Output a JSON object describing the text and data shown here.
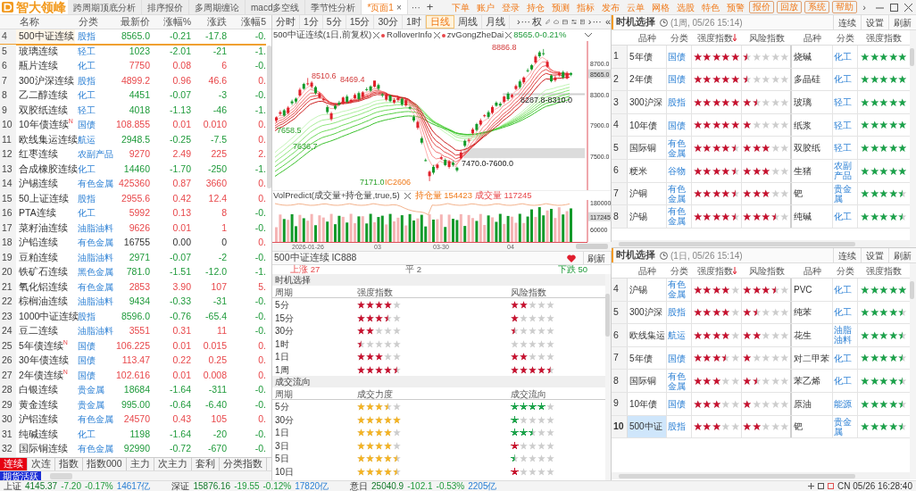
{
  "app": {
    "logo": "智大领峰",
    "tabs": [
      {
        "label": "跨周期顶底分析",
        "selected": false
      },
      {
        "label": "排序报价",
        "selected": false
      },
      {
        "label": "多周期缠论",
        "selected": false
      },
      {
        "label": "macd多空线",
        "selected": false
      },
      {
        "label": "季节性分析",
        "selected": false
      },
      {
        "label": "*页面1",
        "selected": true,
        "close": "×"
      }
    ],
    "tab_more": "···",
    "tab_add": "+",
    "menu": [
      {
        "label": "下单",
        "kind": "link"
      },
      {
        "label": "账户",
        "kind": "link"
      },
      {
        "label": "登录",
        "kind": "link"
      },
      {
        "label": "持仓",
        "kind": "link"
      },
      {
        "label": "预测",
        "kind": "link"
      },
      {
        "label": "指标",
        "kind": "link"
      },
      {
        "label": "发布",
        "kind": "link"
      },
      {
        "label": "云单",
        "kind": "link"
      },
      {
        "label": "网格",
        "kind": "link"
      },
      {
        "label": "选股",
        "kind": "link"
      },
      {
        "label": "特色",
        "kind": "link"
      },
      {
        "label": "预警",
        "kind": "link"
      },
      {
        "label": "报价",
        "kind": "button"
      },
      {
        "label": "回放",
        "kind": "button"
      },
      {
        "label": "系统",
        "kind": "button"
      },
      {
        "label": "帮助",
        "kind": "button"
      }
    ],
    "menu_more": "›"
  },
  "quote_list": {
    "columns": [
      "名称",
      "分类",
      "最新价",
      "涨幅%",
      "涨跌",
      "涨幅5"
    ],
    "rows": [
      {
        "index": "4",
        "name": "500中证连续",
        "category": "股指",
        "price": "8565.0",
        "percent": "-0.21",
        "change": "-17.8",
        "percent5": "-0.",
        "rising": false,
        "rising5": false,
        "selected": true
      },
      {
        "index": "5",
        "name": "玻璃连续",
        "category": "轻工",
        "price": "1023",
        "percent": "-2.01",
        "change": "-21",
        "percent5": "-1.",
        "rising": false,
        "rising5": false,
        "selected": false
      },
      {
        "index": "6",
        "name": "瓶片连续",
        "category": "化工",
        "price": "7750",
        "percent": "0.08",
        "change": "6",
        "percent5": "-0.",
        "rising": true,
        "rising5": false,
        "selected": false
      },
      {
        "index": "7",
        "name": "300沪深连续",
        "category": "股指",
        "price": "4899.2",
        "percent": "0.96",
        "change": "46.6",
        "percent5": "0.",
        "rising": true,
        "rising5": true,
        "selected": false
      },
      {
        "index": "8",
        "name": "乙二醇连续",
        "category": "化工",
        "price": "4451",
        "percent": "-0.07",
        "change": "-3",
        "percent5": "-0.",
        "rising": false,
        "rising5": false,
        "selected": false
      },
      {
        "index": "9",
        "name": "双胶纸连续",
        "category": "轻工",
        "price": "4018",
        "percent": "-1.13",
        "change": "-46",
        "percent5": "-1.",
        "rising": false,
        "rising5": false,
        "selected": false
      },
      {
        "index": "10",
        "name": "10年债连续$^{N}$",
        "category": "国债",
        "price": "108.855",
        "percent": "0.01",
        "change": "0.010",
        "percent5": "0.",
        "rising": true,
        "rising5": true,
        "selected": false
      },
      {
        "index": "11",
        "name": "欧线集运连续",
        "category": "航运",
        "price": "2948.5",
        "percent": "-0.25",
        "change": "-7.5",
        "percent5": "0.",
        "rising": false,
        "rising5": true,
        "selected": false
      },
      {
        "index": "12",
        "name": "红枣连续",
        "category": "农副产品",
        "price": "9270",
        "percent": "2.49",
        "change": "225",
        "percent5": "2.",
        "rising": true,
        "rising5": true,
        "selected": false
      },
      {
        "index": "13",
        "name": "合成橡胶连续",
        "category": "化工",
        "price": "14460",
        "percent": "-1.70",
        "change": "-250",
        "percent5": "-1.",
        "rising": false,
        "rising5": false,
        "selected": false
      },
      {
        "index": "14",
        "name": "沪锡连续",
        "category": "有色金属",
        "price": "425360",
        "percent": "0.87",
        "change": "3660",
        "percent5": "0.",
        "rising": true,
        "rising5": true,
        "selected": false
      },
      {
        "index": "15",
        "name": "50上证连续",
        "category": "股指",
        "price": "2955.6",
        "percent": "0.42",
        "change": "12.4",
        "percent5": "0.",
        "rising": true,
        "rising5": true,
        "selected": false
      },
      {
        "index": "16",
        "name": "PTA连续",
        "category": "化工",
        "price": "5992",
        "percent": "0.13",
        "change": "8",
        "percent5": "-0.",
        "rising": true,
        "rising5": false,
        "selected": false
      },
      {
        "index": "17",
        "name": "菜籽油连续",
        "category": "油脂油料",
        "price": "9626",
        "percent": "0.01",
        "change": "1",
        "percent5": "-0.",
        "rising": true,
        "rising5": false,
        "selected": false
      },
      {
        "index": "18",
        "name": "沪铅连续",
        "category": "有色金属",
        "price": "16755",
        "percent": "0.00",
        "change": "0",
        "percent5": "0.",
        "rising5": true,
        "selected": false
      },
      {
        "index": "19",
        "name": "豆粕连续",
        "category": "油脂油料",
        "price": "2971",
        "percent": "-0.07",
        "change": "-2",
        "percent5": "-0.",
        "rising": false,
        "rising5": false,
        "selected": false
      },
      {
        "index": "20",
        "name": "铁矿石连续",
        "category": "黑色金属",
        "price": "781.0",
        "percent": "-1.51",
        "change": "-12.0",
        "percent5": "-1.",
        "rising": false,
        "rising5": false,
        "selected": false
      },
      {
        "index": "21",
        "name": "氧化铝连续",
        "category": "有色金属",
        "price": "2853",
        "percent": "3.90",
        "change": "107",
        "percent5": "5.",
        "rising": true,
        "rising5": true,
        "selected": false
      },
      {
        "index": "22",
        "name": "棕榈油连续",
        "category": "油脂油料",
        "price": "9434",
        "percent": "-0.33",
        "change": "-31",
        "percent5": "-0.",
        "rising": false,
        "rising5": false,
        "selected": false
      },
      {
        "index": "23",
        "name": "1000中证连续",
        "category": "股指",
        "price": "8596.0",
        "percent": "-0.76",
        "change": "-65.4",
        "percent5": "-0.",
        "rising": false,
        "rising5": false,
        "selected": false
      },
      {
        "index": "24",
        "name": "豆二连续",
        "category": "油脂油料",
        "price": "3551",
        "percent": "0.31",
        "change": "11",
        "percent5": "-0.",
        "rising": true,
        "rising5": false,
        "selected": false
      },
      {
        "index": "25",
        "name": "5年债连续$^{N}$",
        "category": "国债",
        "price": "106.225",
        "percent": "0.01",
        "change": "0.015",
        "percent5": "0.",
        "rising": true,
        "rising5": true,
        "selected": false
      },
      {
        "index": "26",
        "name": "30年债连续",
        "category": "国债",
        "price": "113.47",
        "percent": "0.22",
        "change": "0.25",
        "percent5": "0.",
        "rising": true,
        "rising5": true,
        "selected": false
      },
      {
        "index": "27",
        "name": "2年债连续$^{N}$",
        "category": "国债",
        "price": "102.616",
        "percent": "0.01",
        "change": "0.008",
        "percent5": "0.",
        "rising": true,
        "rising5": true,
        "selected": false
      },
      {
        "index": "28",
        "name": "白银连续",
        "category": "贵金属",
        "price": "18684",
        "percent": "-1.64",
        "change": "-311",
        "percent5": "-0.",
        "rising": false,
        "rising5": false,
        "selected": false
      },
      {
        "index": "29",
        "name": "黄金连续",
        "category": "贵金属",
        "price": "995.00",
        "percent": "-0.64",
        "change": "-6.40",
        "percent5": "-0.",
        "rising": false,
        "rising5": false,
        "selected": false
      },
      {
        "index": "30",
        "name": "沪铝连续",
        "category": "有色金属",
        "price": "24570",
        "percent": "0.43",
        "change": "105",
        "percent5": "0.",
        "rising": true,
        "rising5": true,
        "selected": false
      },
      {
        "index": "31",
        "name": "纯碱连续",
        "category": "化工",
        "price": "1198",
        "percent": "-1.64",
        "change": "-20",
        "percent5": "-0.",
        "rising": false,
        "rising5": false,
        "selected": false
      },
      {
        "index": "32",
        "name": "国际铜连续",
        "category": "有色金属",
        "price": "92990",
        "percent": "-0.72",
        "change": "-670",
        "percent5": "-0.",
        "rising": false,
        "rising5": false,
        "selected": false
      }
    ],
    "bottom_tabs": [
      {
        "label": "连续",
        "selected": true
      },
      {
        "label": "次连",
        "selected": false
      },
      {
        "label": "指数",
        "selected": false
      },
      {
        "label": "指数000",
        "selected": false
      },
      {
        "label": "主力",
        "selected": false
      },
      {
        "label": "次主力",
        "selected": false
      },
      {
        "label": "套利",
        "selected": false
      },
      {
        "label": "分类指数",
        "selected": false
      }
    ],
    "board": "期货活跃"
  },
  "chart": {
    "periods": [
      {
        "label": "分时",
        "selected": false
      },
      {
        "label": "1分",
        "selected": false
      },
      {
        "label": "5分",
        "selected": false
      },
      {
        "label": "15分",
        "selected": false
      },
      {
        "label": "30分",
        "selected": false
      },
      {
        "label": "1时",
        "selected": false
      },
      {
        "label": "日线",
        "selected": true
      },
      {
        "label": "周线",
        "selected": false
      },
      {
        "label": "月线",
        "selected": false
      }
    ],
    "toolbar_more": "›",
    "toolbar_dots": "···",
    "adjust": "权",
    "toolbar_more2": "›",
    "toolbar_dots2": "···",
    "collapse": "«",
    "legend": {
      "title": "500中证连续(1日,前复权)",
      "indicators": [
        "RolloverInfo",
        "zvGongZheDai"
      ],
      "quote": "8565.0-0.21%"
    },
    "price_labels": [
      {
        "text": "8886.8",
        "kind": "high"
      },
      {
        "text": "8510.6",
        "kind": "high"
      },
      {
        "text": "8469.4",
        "kind": "high"
      },
      {
        "text": "7658.5",
        "kind": "low"
      },
      {
        "text": "7636.7",
        "kind": "low"
      },
      {
        "text": "7171.0",
        "kind": "low"
      },
      {
        "text": "IC2606",
        "kind": "contract"
      },
      {
        "text": "7470.0-7600.0",
        "kind": "zone"
      },
      {
        "text": "8287.8-8310.0",
        "kind": "zone"
      }
    ],
    "price_axis": [
      "8700.0",
      "8565.0",
      "8300.0",
      "7900.0",
      "7500.0"
    ],
    "volume_legend": {
      "title": "VolPredict(成交量+持仓量,true,5)",
      "open_interest": "持仓量 154423",
      "volume": "成交量 117245"
    },
    "volume_axis": [
      "180000",
      "117245",
      "60000"
    ],
    "date_axis": [
      "2026-01-26",
      "03",
      "03-30",
      "04"
    ]
  },
  "detail": {
    "title": "500中证连续 IC888",
    "refresh": "刷新",
    "breadth": {
      "up": "上涨 27",
      "flat": "平 2",
      "down": "下跌 50"
    },
    "timing": {
      "title": "时机选择",
      "columns": [
        "周期",
        "强度指数",
        "风险指数"
      ],
      "rows": [
        {
          "period": "5分",
          "strength": {
            "stars": 4
          },
          "risk": {
            "stars": 2
          }
        },
        {
          "period": "15分",
          "strength": {
            "stars": 3.5
          },
          "risk": {
            "stars": 1
          }
        },
        {
          "period": "30分",
          "strength": {
            "stars": 2
          },
          "risk": {
            "stars": 0.5
          }
        },
        {
          "period": "1时",
          "strength": {
            "stars": 0.5
          },
          "risk": {
            "stars": 0
          }
        },
        {
          "period": "1日",
          "strength": {
            "stars": 3
          },
          "risk": {
            "stars": 2
          }
        },
        {
          "period": "1周",
          "strength": {
            "stars": 4.5
          },
          "risk": {
            "stars": 4.5
          }
        }
      ]
    },
    "flow": {
      "title": "成交流向",
      "columns": [
        "周期",
        "成交力度",
        "成交流向"
      ],
      "rows": [
        {
          "period": "5分",
          "force": {
            "stars": 3.5
          },
          "direction": {
            "stars": 4,
            "color": "#1aa34a"
          }
        },
        {
          "period": "30分",
          "force": {
            "stars": 5
          },
          "direction": {
            "stars": 1,
            "color": "#1aa34a"
          }
        },
        {
          "period": "1日",
          "force": {
            "stars": 4
          },
          "direction": {
            "stars": 2.5,
            "color": "#1aa34a"
          }
        },
        {
          "period": "3日",
          "force": {
            "stars": 4
          },
          "direction": {
            "stars": 1,
            "color": "#c8102e"
          }
        },
        {
          "period": "5日",
          "force": {
            "stars": 4.5
          },
          "direction": {
            "stars": 0.5,
            "color": "#1aa34a"
          }
        },
        {
          "period": "10日",
          "force": {
            "stars": 4.5
          },
          "direction": {
            "stars": 1,
            "color": "#c8102e"
          }
        }
      ]
    }
  },
  "timing_panels": [
    {
      "title": "时机选择",
      "subtitle": "(1周, 05/26 15:14)",
      "buttons": [
        "连续",
        "设置",
        "刷新"
      ],
      "columns": [
        {
          "label": "品种",
          "sorted": false
        },
        {
          "label": "分类",
          "sorted": false
        },
        {
          "label": "强度指数",
          "sorted": true
        },
        {
          "label": "风险指数",
          "sorted": false
        },
        {
          "label": "品种",
          "sorted": false
        },
        {
          "label": "分类",
          "sorted": false
        },
        {
          "label": "强度指数",
          "sorted": false
        }
      ],
      "rows": [
        {
          "index": "1",
          "name": "5年债",
          "category": "国债",
          "strength": {
            "stars": 5
          },
          "risk": {
            "stars": 0.5
          },
          "name2": "烧碱",
          "category2": "化工",
          "strength2": {
            "stars": 5
          },
          "selected": false
        },
        {
          "index": "2",
          "name": "2年债",
          "category": "国债",
          "strength": {
            "stars": 5
          },
          "risk": {
            "stars": 0.5
          },
          "name2": "多晶硅",
          "category2": "化工",
          "strength2": {
            "stars": 5
          },
          "selected": false
        },
        {
          "index": "3",
          "name": "300沪深",
          "category": "股指",
          "strength": {
            "stars": 5
          },
          "risk": {
            "stars": 1.5
          },
          "name2": "玻璃",
          "category2": "轻工",
          "strength2": {
            "stars": 5
          },
          "selected": false
        },
        {
          "index": "4",
          "name": "10年债",
          "category": "国债",
          "strength": {
            "stars": 5
          },
          "risk": {
            "stars": 1
          },
          "name2": "纸浆",
          "category2": "轻工",
          "strength2": {
            "stars": 5
          },
          "selected": false
        },
        {
          "index": "5",
          "name": "国际铜",
          "category": "有色金属",
          "strength": {
            "stars": 4.5
          },
          "risk": {
            "stars": 3
          },
          "name2": "双胶纸",
          "category2": "轻工",
          "strength2": {
            "stars": 5
          },
          "selected": false
        },
        {
          "index": "6",
          "name": "粳米",
          "category": "谷物",
          "strength": {
            "stars": 4.5
          },
          "risk": {
            "stars": 3
          },
          "name2": "生猪",
          "category2": "农副产品",
          "strength2": {
            "stars": 5
          },
          "selected": false
        },
        {
          "index": "7",
          "name": "沪铜",
          "category": "有色金属",
          "strength": {
            "stars": 4.5
          },
          "risk": {
            "stars": 3
          },
          "name2": "钯",
          "category2": "贵金属",
          "strength2": {
            "stars": 4.5
          },
          "selected": false
        },
        {
          "index": "8",
          "name": "沪锡",
          "category": "有色金属",
          "strength": {
            "stars": 4.5
          },
          "risk": {
            "stars": 3.5
          },
          "name2": "纯碱",
          "category2": "化工",
          "strength2": {
            "stars": 4.5
          },
          "selected": false
        }
      ]
    },
    {
      "title": "时机选择",
      "subtitle": "(1日, 05/26 15:14)",
      "buttons": [
        "连续",
        "设置",
        "刷新"
      ],
      "columns": [
        {
          "label": "品种",
          "sorted": false
        },
        {
          "label": "分类",
          "sorted": false
        },
        {
          "label": "强度指数",
          "sorted": true
        },
        {
          "label": "风险指数",
          "sorted": false
        },
        {
          "label": "品种",
          "sorted": false
        },
        {
          "label": "分类",
          "sorted": false
        },
        {
          "label": "强度指数",
          "sorted": false
        }
      ],
      "rows": [
        {
          "index": "4",
          "name": "沪锡",
          "category": "有色金属",
          "strength": {
            "stars": 4
          },
          "risk": {
            "stars": 3.5
          },
          "name2": "PVC",
          "category2": "化工",
          "strength2": {
            "stars": 5
          },
          "selected": false
        },
        {
          "index": "5",
          "name": "300沪深",
          "category": "股指",
          "strength": {
            "stars": 4
          },
          "risk": {
            "stars": 1.5
          },
          "name2": "纯苯",
          "category2": "化工",
          "strength2": {
            "stars": 4.5
          },
          "selected": false
        },
        {
          "index": "6",
          "name": "欧线集运",
          "category": "航运",
          "strength": {
            "stars": 4
          },
          "risk": {
            "stars": 2
          },
          "name2": "花生",
          "category2": "油脂油料",
          "strength2": {
            "stars": 4.5
          },
          "selected": false
        },
        {
          "index": "7",
          "name": "5年债",
          "category": "国债",
          "strength": {
            "stars": 3.5
          },
          "risk": {
            "stars": 1
          },
          "name2": "对二甲苯",
          "category2": "化工",
          "strength2": {
            "stars": 4.5
          },
          "selected": false
        },
        {
          "index": "8",
          "name": "国际铜",
          "category": "有色金属",
          "strength": {
            "stars": 3
          },
          "risk": {
            "stars": 1.5
          },
          "name2": "苯乙烯",
          "category2": "化工",
          "strength2": {
            "stars": 4.5
          },
          "selected": false
        },
        {
          "index": "9",
          "name": "10年债",
          "category": "国债",
          "strength": {
            "stars": 3
          },
          "risk": {
            "stars": 1
          },
          "name2": "原油",
          "category2": "能源",
          "strength2": {
            "stars": 4.5
          },
          "selected": false
        },
        {
          "index": "10",
          "name": "500中证",
          "category": "股指",
          "strength": {
            "stars": 3
          },
          "risk": {
            "stars": 2
          },
          "name2": "钯",
          "category2": "贵金属",
          "strength2": {
            "stars": 4.5
          },
          "selected": true
        }
      ]
    }
  ],
  "status_bar": {
    "indices": [
      {
        "name": "上证",
        "value": "4145.37",
        "change": "-7.20",
        "percent": "-0.17%",
        "amount": "14617亿"
      },
      {
        "name": "深证",
        "value": "15876.16",
        "change": "-19.55",
        "percent": "-0.12%",
        "amount": "17820亿"
      },
      {
        "name": "意日",
        "value": "25040.9",
        "change": "-102.1",
        "percent": "-0.53%",
        "amount": "2205亿"
      }
    ],
    "clock": "CN 05/26 16:28:40"
  }
}
